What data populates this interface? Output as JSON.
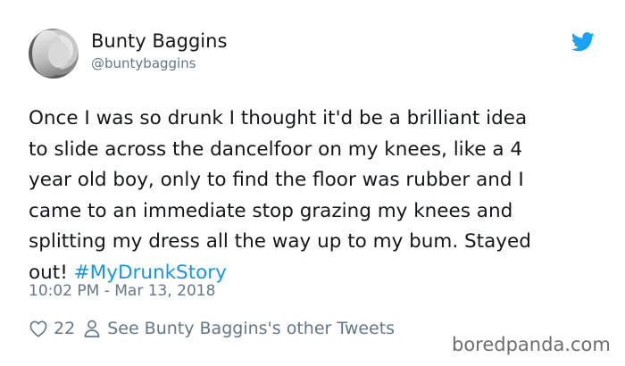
{
  "tweet": {
    "author_name": "Bunty Baggins",
    "author_handle": "@buntybaggins",
    "text_main": "Once I was so drunk I thought it'd be a brilliant idea\nto slide across the dancelfoor on my knees, like a 4\nyear old boy, only to find the floor was rubber and I\ncame to an immediate stop grazing my knees and\nsplitting my dress all the way up to my bum. Stayed\nout! ",
    "hashtag": "#MyDrunkStory",
    "timestamp": "10:02 PM - Mar 13, 2018",
    "like_count": "22",
    "other_tweets_link": "See Bunty Baggins's other Tweets"
  },
  "icons": {
    "twitter_logo": "twitter-bird-icon",
    "like": "heart-icon",
    "profile": "person-icon"
  },
  "colors": {
    "text": "#14171a",
    "secondary": "#657786",
    "link": "#1b95e0",
    "twitter_blue": "#1da1f2"
  },
  "watermark": "boredpanda.com"
}
